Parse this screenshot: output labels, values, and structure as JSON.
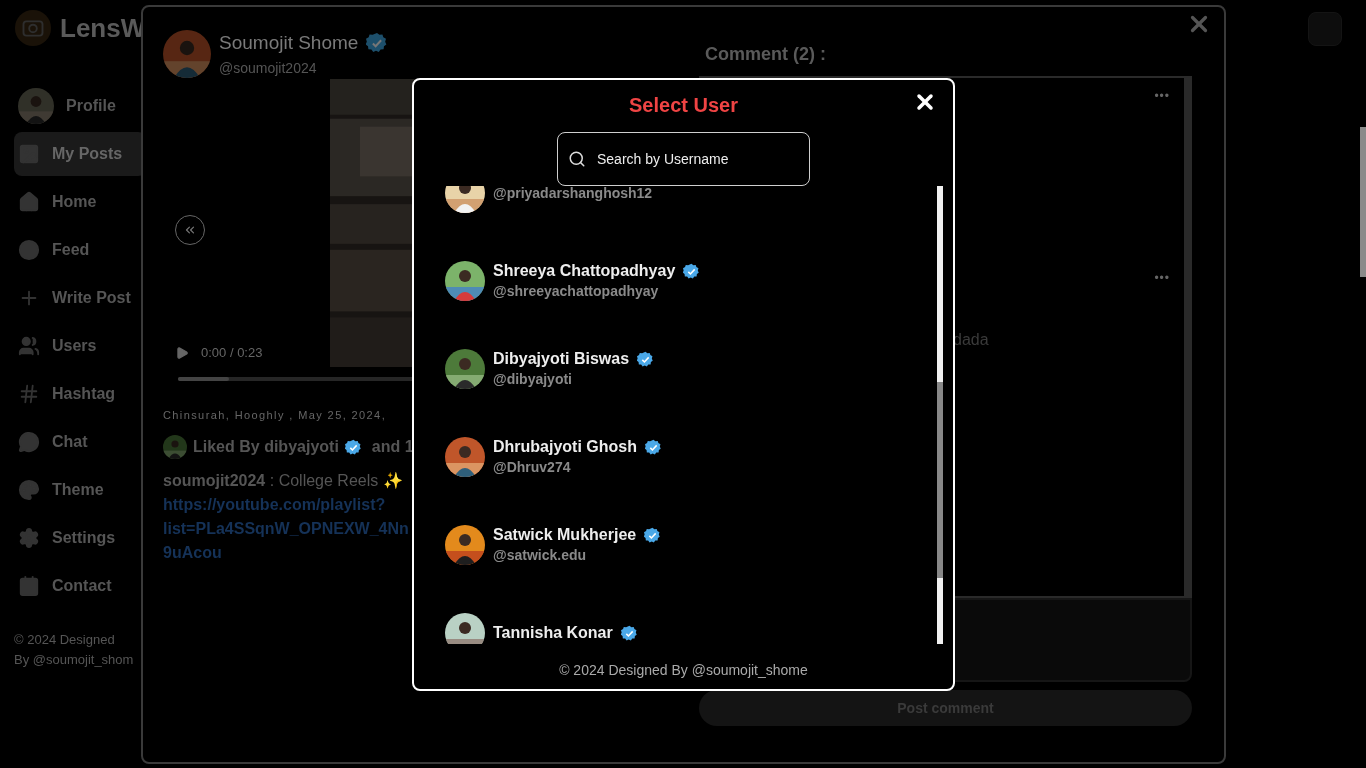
{
  "app": {
    "logo": "LensW",
    "nav": [
      {
        "label": "Profile",
        "selected": false
      },
      {
        "label": "My Posts",
        "selected": true
      },
      {
        "label": "Home",
        "selected": false
      },
      {
        "label": "Feed",
        "selected": false
      },
      {
        "label": "Write Post",
        "selected": false
      },
      {
        "label": "Users",
        "selected": false
      },
      {
        "label": "Hashtag",
        "selected": false
      },
      {
        "label": "Chat",
        "selected": false
      },
      {
        "label": "Theme",
        "selected": false
      },
      {
        "label": "Settings",
        "selected": false
      },
      {
        "label": "Contact",
        "selected": false
      }
    ],
    "footer_lines": [
      "© 2024 Designed",
      "By @soumojit_shom"
    ]
  },
  "post": {
    "author": {
      "name": "Soumojit Shome",
      "handle": "@soumojit2024",
      "verified": true
    },
    "video": {
      "time": "0:00 / 0:23",
      "level": 0.1
    },
    "location_date": "Chinsurah, Hooghly , May 25, 2024,",
    "liked": {
      "prefix": "Liked By",
      "user": "dibyajyoti",
      "verified": true,
      "suffix": "and 1"
    },
    "caption": {
      "user": "soumojit2024",
      "separator": ":",
      "text": "College Reels ✨",
      "link_lines": [
        "https://youtube.com/playlist?",
        "list=PLa4SSqnW_OPNEXW_4Nn",
        "9uAcou"
      ]
    },
    "comments": {
      "title": "Comment (2) :",
      "items": [
        {
          "kind": "hidden",
          "menu": "•••"
        },
        {
          "kind": "text",
          "menu": "•••",
          "text": "dada"
        }
      ]
    },
    "post_button": "Post comment"
  },
  "select_user": {
    "title": "Select User",
    "search": {
      "placeholder": "Search by Username"
    },
    "users": [
      {
        "handle": "@priyadarshanghosh12"
      },
      {
        "name": "Shreeya Chattopadhyay",
        "handle": "@shreeyachattopadhyay",
        "verified": true
      },
      {
        "name": "Dibyajyoti Biswas",
        "handle": "@dibyajyoti",
        "verified": true
      },
      {
        "name": "Dhrubajyoti Ghosh",
        "handle": "@Dhruv274",
        "verified": true
      },
      {
        "name": "Satwick Mukherjee",
        "handle": "@satwick.edu",
        "verified": true
      },
      {
        "name": "Tannisha Konar",
        "verified": true
      }
    ],
    "footer": "© 2024 Designed By @soumojit_shome"
  }
}
